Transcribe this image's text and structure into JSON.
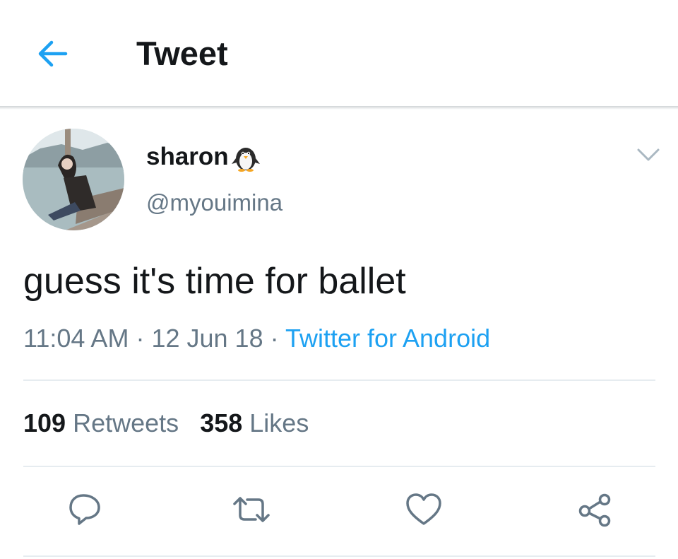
{
  "header": {
    "title": "Tweet",
    "back_icon": "back-arrow-icon"
  },
  "tweet": {
    "author_name": "sharon",
    "author_emoji": "penguin-emoji",
    "handle": "@myouimina",
    "text": "guess it's time for ballet",
    "time": "11:04 AM",
    "date": "12 Jun 18",
    "separator": "·",
    "source": "Twitter for Android"
  },
  "stats": {
    "retweets_count": "109",
    "retweets_label": "Retweets",
    "likes_count": "358",
    "likes_label": "Likes"
  },
  "actions": [
    "reply-icon",
    "retweet-icon",
    "like-icon",
    "share-icon"
  ],
  "colors": {
    "accent": "#1da1f2",
    "secondary_text": "#657786",
    "primary_text": "#14171a"
  }
}
